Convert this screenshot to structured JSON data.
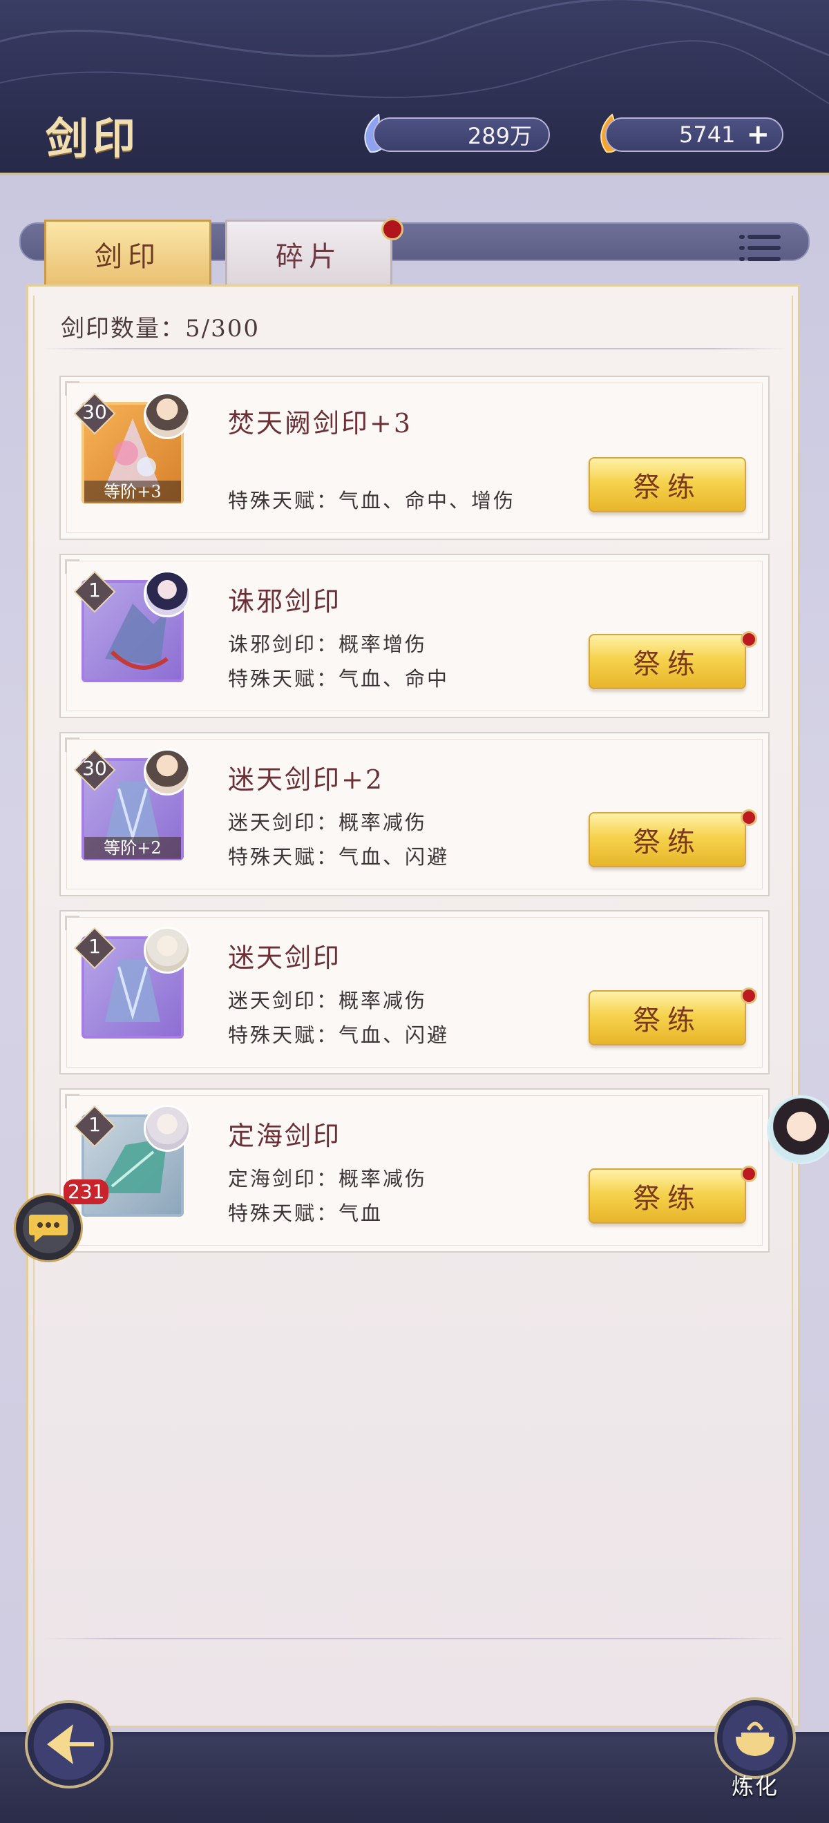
{
  "header": {
    "title": "剑印",
    "resources": [
      {
        "icon": "jade-icon",
        "value": "289万"
      },
      {
        "icon": "gold-flame-icon",
        "value": "5741",
        "action": "+"
      }
    ]
  },
  "tabs": [
    {
      "label": "剑印",
      "active": true
    },
    {
      "label": "碎片",
      "active": false,
      "notification": true
    }
  ],
  "inventory": {
    "count_label": "剑印数量：5/300"
  },
  "cards": [
    {
      "level": "30",
      "name": "焚天阙剑印+3",
      "grade": "等阶+3",
      "lines": [
        "特殊天赋：气血、命中、增伤"
      ],
      "button": "祭练",
      "dot": false,
      "rarity": "orange"
    },
    {
      "level": "1",
      "name": "诛邪剑印",
      "grade": "",
      "lines": [
        "诛邪剑印：概率增伤",
        "特殊天赋：气血、命中"
      ],
      "button": "祭练",
      "dot": true,
      "rarity": "purple"
    },
    {
      "level": "30",
      "name": "迷天剑印+2",
      "grade": "等阶+2",
      "lines": [
        "迷天剑印：概率减伤",
        "特殊天赋：气血、闪避"
      ],
      "button": "祭练",
      "dot": true,
      "rarity": "purple"
    },
    {
      "level": "1",
      "name": "迷天剑印",
      "grade": "",
      "lines": [
        "迷天剑印：概率减伤",
        "特殊天赋：气血、闪避"
      ],
      "button": "祭练",
      "dot": true,
      "rarity": "purple"
    },
    {
      "level": "1",
      "name": "定海剑印",
      "grade": "",
      "lines": [
        "定海剑印：概率减伤",
        "特殊天赋：气血"
      ],
      "button": "祭练",
      "dot": true,
      "rarity": "blue"
    }
  ],
  "chat": {
    "badge": "231"
  },
  "bottom": {
    "refine_label": "炼化"
  },
  "colors": {
    "accent_gold": "#f6d34d",
    "title_red": "#6b2f35",
    "badge_red": "#c9232b"
  }
}
